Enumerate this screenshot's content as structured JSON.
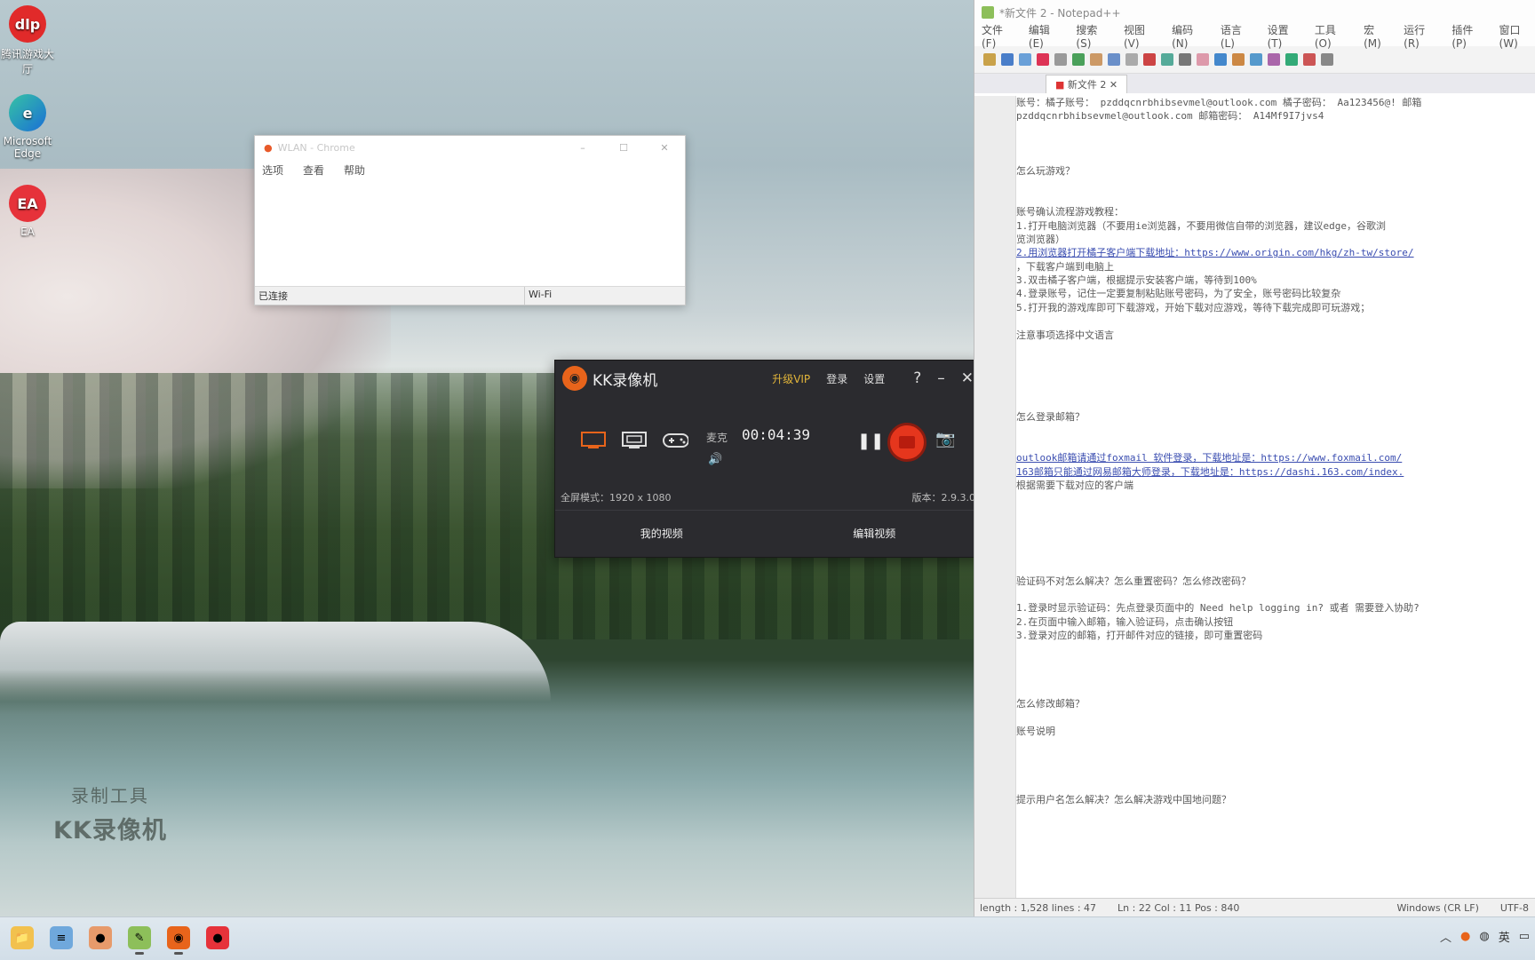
{
  "desktop": {
    "icons": [
      {
        "label": "腾讯游戏大厅"
      },
      {
        "label": "Microsoft Edge"
      },
      {
        "label": "EA"
      }
    ],
    "watermark": {
      "line1": "录制工具",
      "line2": "KK录像机"
    }
  },
  "mini_window": {
    "title": "WLAN - Chrome",
    "menu": [
      "选项",
      "查看",
      "帮助"
    ],
    "status_left": "已连接",
    "status_right": "Wi-Fi"
  },
  "kk_recorder": {
    "title": "KK录像机",
    "links": [
      "升级VIP",
      "登录",
      "设置"
    ],
    "help": "?",
    "minimize": "–",
    "close": "✕",
    "mic_label": "麦克",
    "timer": "00:04:39",
    "mode_info": "全屏模式：1920 x 1080",
    "version": "版本：2.9.3.0",
    "bottom_buttons": [
      "我的视频",
      "编辑视频"
    ]
  },
  "notepad": {
    "title": "*新文件 2 - Notepad++",
    "menu": [
      "文件(F)",
      "编辑(E)",
      "搜索(S)",
      "视图(V)",
      "编码(N)",
      "语言(L)",
      "设置(T)",
      "工具(O)",
      "宏(M)",
      "运行(R)",
      "插件(P)",
      "窗口(W)"
    ],
    "tab": "新文件 2",
    "lines": [
      "账号：橘子账号： pzddqcnrbhibsevmel@outlook.com 橘子密码： Aa123456@! 邮箱",
      "pzddqcnrbhibsevmel@outlook.com 邮箱密码： A14Mf9I7jvs4",
      "",
      "",
      "",
      "怎么玩游戏？",
      "",
      "",
      "账号确认流程游戏教程：",
      "1.打开电脑浏览器（不要用ie浏览器，不要用微信自带的浏览器，建议edge，谷歌浏",
      "览浏览器）",
      "2.用浏览器打开橘子客户端下载地址：https://www.origin.com/hkg/zh-tw/store/",
      "，下载客户端到电脑上",
      "3.双击橘子客户端，根据提示安装客户端，等待到100%",
      "4.登录账号，记住一定要复制粘贴账号密码，为了安全，账号密码比较复杂",
      "5.打开我的游戏库即可下载游戏，开始下载对应游戏，等待下载完成即可玩游戏；",
      "",
      "注意事项选择中文语言",
      "",
      "",
      "",
      "",
      "",
      "怎么登录邮箱？",
      "",
      "",
      "outlook邮箱请通过foxmail 软件登录，下载地址是：https://www.foxmail.com/",
      "163邮箱只能通过网易邮箱大师登录，下载地址是：https://dashi.163.com/index.",
      "根据需要下载对应的客户端",
      "",
      "",
      "",
      "",
      "",
      "",
      "验证码不对怎么解决？怎么重置密码？怎么修改密码？",
      "",
      "1.登录时显示验证码：先点登录页面中的 Need help logging in? 或者 需要登入协助?",
      "2.在页面中输入邮箱，输入验证码，点击确认按钮",
      "3.登录对应的邮箱，打开邮件对应的链接，即可重置密码",
      "",
      "",
      "",
      "",
      "怎么修改邮箱？",
      "",
      "账号说明",
      "",
      "",
      "",
      "",
      "提示用户名怎么解决？怎么解决游戏中国地问题？"
    ],
    "status": {
      "length": "length : 1,528    lines : 47",
      "position": "Ln : 22    Col : 11    Pos : 840",
      "eol": "Windows (CR LF)",
      "encoding": "UTF-8"
    }
  },
  "taskbar": {
    "tray_lang": "英"
  }
}
